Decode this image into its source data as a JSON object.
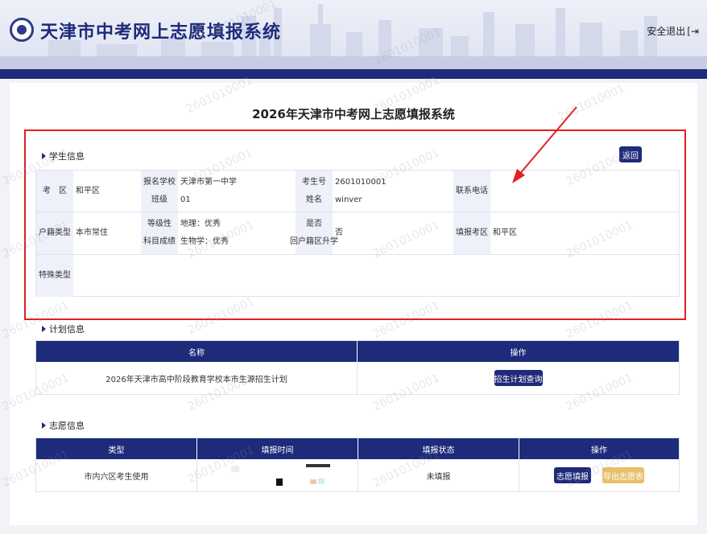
{
  "header": {
    "site_title": "天津市中考网上志愿填报系统",
    "logout_label": "安全退出",
    "logout_icon": "logout-icon"
  },
  "page": {
    "title": "2026年天津市中考网上志愿填报系统"
  },
  "student": {
    "section_title": "学生信息",
    "back_label": "返回",
    "district_label": "考　区",
    "district_value": "和平区",
    "school_label": "报名学校",
    "school_value": "天津市第一中学",
    "class_label": "班级",
    "class_value": "01",
    "exam_no_label": "考生号",
    "exam_no_value": "2601010001",
    "name_label": "姓名",
    "name_value": "winver",
    "phone_label": "联系电话",
    "phone_value": "",
    "hukou_label": "户籍类型",
    "hukou_value": "本市常住",
    "grade_label_1": "等级性",
    "grade_label_2": "科目成绩",
    "grade_value_1": "地理：优秀",
    "grade_value_2": "生物学：优秀",
    "return_label_1": "是否",
    "return_label_2": "回户籍区升学",
    "return_value": "否",
    "fill_district_label": "填报考区",
    "fill_district_value": "和平区",
    "special_label": "特殊类型",
    "special_value": ""
  },
  "plan": {
    "section_title": "计划信息",
    "columns": [
      "名称",
      "操作"
    ],
    "rows": [
      {
        "name": "2026年天津市高中阶段教育学校本市生源招生计划",
        "action": "招生计划查询"
      }
    ]
  },
  "wish": {
    "section_title": "志愿信息",
    "columns": [
      "类型",
      "填报时间",
      "填报状态",
      "操作"
    ],
    "rows": [
      {
        "type": "市内六区考生使用",
        "time": "",
        "status": "未填报",
        "fill_label": "志愿填报",
        "export_label": "导出志愿表"
      }
    ]
  },
  "watermark": "2601010001",
  "colors": {
    "primary": "#1e2a7a",
    "highlight": "#e02020",
    "gold": "#e7c06a",
    "status_red": "#e02020"
  }
}
